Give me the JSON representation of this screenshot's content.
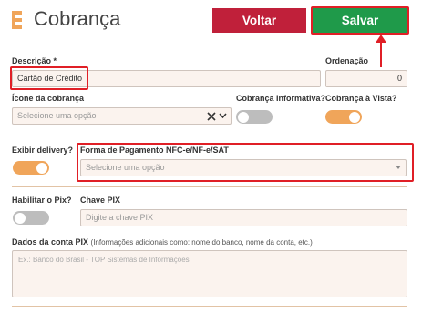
{
  "header": {
    "title": "Cobrança",
    "back_label": "Voltar",
    "save_label": "Salvar"
  },
  "form": {
    "descricao": {
      "label": "Descrição *",
      "value": "Cartão de Crédito"
    },
    "ordenacao": {
      "label": "Ordenação",
      "value": "0"
    },
    "icone": {
      "label": "Ícone da cobrança",
      "placeholder": "Selecione uma opção"
    },
    "cobranca_informativa": {
      "label": "Cobrança Informativa?",
      "on": false
    },
    "cobranca_a_vista": {
      "label": "Cobrança à Vista?",
      "on": true
    },
    "exibir_delivery": {
      "label": "Exibir delivery?",
      "on": true
    },
    "forma_pagamento": {
      "label": "Forma de Pagamento NFC-e/NF-e/SAT",
      "placeholder": "Selecione uma opção"
    },
    "habilitar_pix": {
      "label": "Habilitar o Pix?",
      "on": false
    },
    "chave_pix": {
      "label": "Chave PIX",
      "placeholder": "Digite a chave PIX"
    },
    "dados_conta_pix": {
      "label": "Dados da conta PIX",
      "note": "(Informações adicionais como: nome do banco, nome da conta, etc.)",
      "placeholder": "Ex.: Banco do Brasil - TOP Sistemas de Informações"
    }
  },
  "icons": {
    "header": "card-icon",
    "clear": "close-icon",
    "dropdown": "chevron-down-icon"
  },
  "colors": {
    "accent": "#f0a55a",
    "back": "#c0203a",
    "save": "#1f9a4a",
    "highlight": "#e01f26"
  }
}
